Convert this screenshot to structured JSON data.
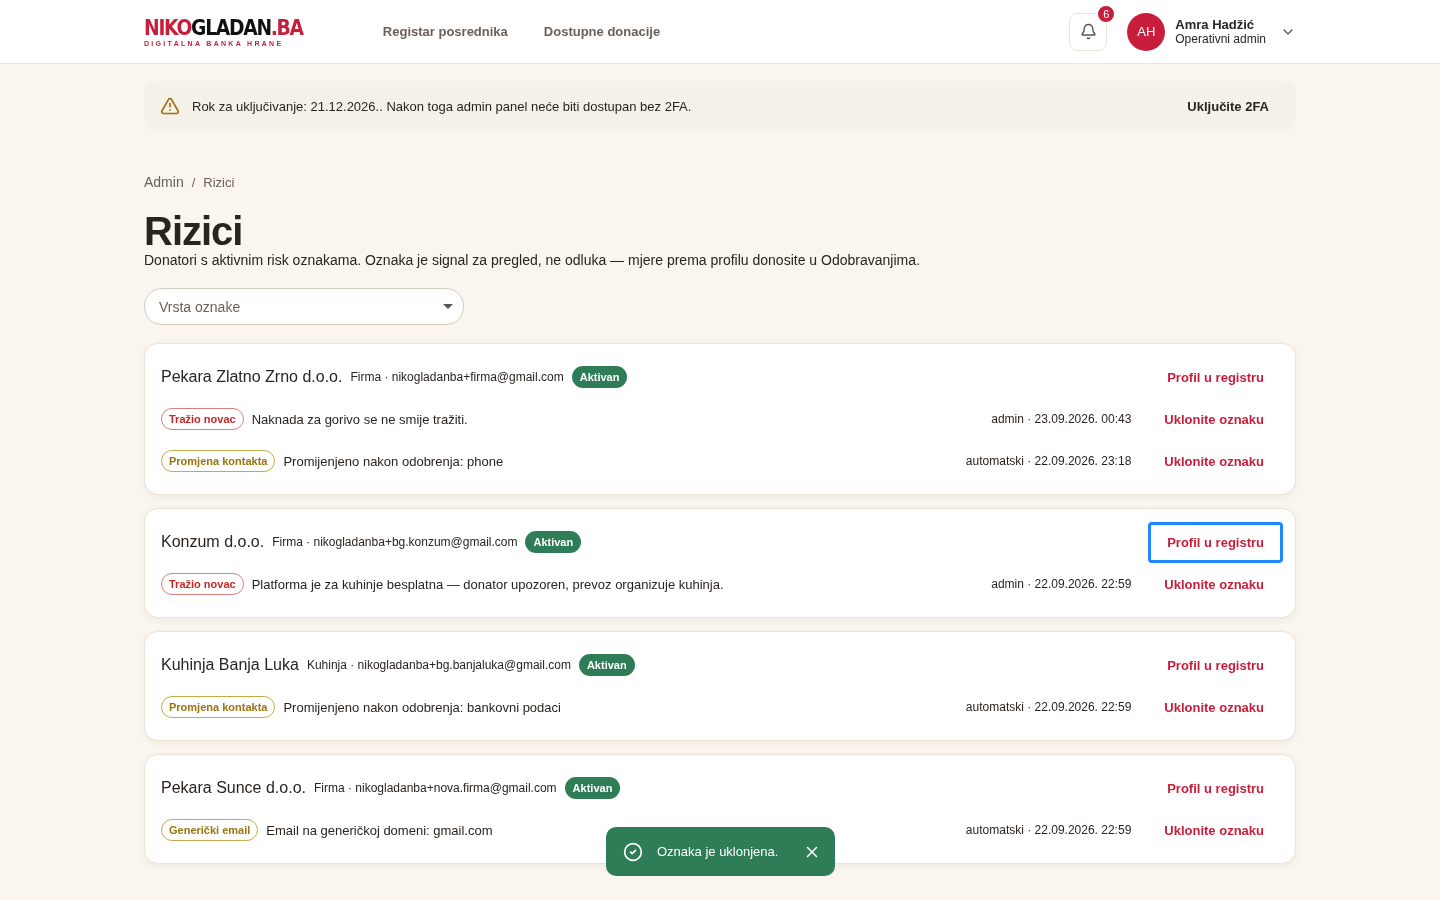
{
  "header": {
    "logo": {
      "parts": [
        {
          "text": "NIKO",
          "kind": "accent"
        },
        {
          "text": "GLADAN",
          "kind": "plain"
        },
        {
          "text": ".BA",
          "kind": "accent"
        }
      ],
      "tagline": "DIGITALNA BANKA HRANE"
    },
    "nav": [
      "Registar posrednika",
      "Dostupne donacije"
    ],
    "notifications": {
      "count": "6"
    },
    "user": {
      "initials": "AH",
      "name": "Amra Hadžić",
      "role": "Operativni admin"
    }
  },
  "alert": {
    "text": "Rok za uključivanje: 21.12.2026.. Nakon toga admin panel neće biti dostupan bez 2FA.",
    "action": "Uključite 2FA"
  },
  "breadcrumb": {
    "items": [
      "Admin",
      "Rizici"
    ],
    "separator": "/"
  },
  "title": "Rizici",
  "subtitle": "Donatori s aktivnim risk oznakama. Oznaka je signal za pregled, ne odluka — mjere prema profilu donosite u Odobravanjima.",
  "filter": {
    "placeholder": "Vrsta oznake"
  },
  "cards": [
    {
      "name": "Pekara Zlatno Zrno d.o.o.",
      "meta": "Firma · nikogladanba+firma@gmail.com",
      "status": "Aktivan",
      "link": "Profil u registru",
      "focused": false,
      "flags": [
        {
          "tag": "Tražio novac",
          "kind": "danger",
          "text": "Naknada za gorivo se ne smije tražiti.",
          "by": "admin · 23.09.2026. 00:43",
          "action": "Uklonite oznaku"
        },
        {
          "tag": "Promjena kontakta",
          "kind": "warning",
          "text": "Promijenjeno nakon odobrenja: phone",
          "by": "automatski · 22.09.2026. 23:18",
          "action": "Uklonite oznaku"
        }
      ]
    },
    {
      "name": "Konzum d.o.o.",
      "meta": "Firma · nikogladanba+bg.konzum@gmail.com",
      "status": "Aktivan",
      "link": "Profil u registru",
      "focused": true,
      "flags": [
        {
          "tag": "Tražio novac",
          "kind": "danger",
          "text": "Platforma je za kuhinje besplatna — donator upozoren, prevoz organizuje kuhinja.",
          "by": "admin · 22.09.2026. 22:59",
          "action": "Uklonite oznaku"
        }
      ]
    },
    {
      "name": "Kuhinja Banja Luka",
      "meta": "Kuhinja · nikogladanba+bg.banjaluka@gmail.com",
      "status": "Aktivan",
      "link": "Profil u registru",
      "focused": false,
      "flags": [
        {
          "tag": "Promjena kontakta",
          "kind": "warning",
          "text": "Promijenjeno nakon odobrenja: bankovni podaci",
          "by": "automatski · 22.09.2026. 22:59",
          "action": "Uklonite oznaku"
        }
      ]
    },
    {
      "name": "Pekara Sunce d.o.o.",
      "meta": "Firma · nikogladanba+nova.firma@gmail.com",
      "status": "Aktivan",
      "link": "Profil u registru",
      "focused": false,
      "flags": [
        {
          "tag": "Generički email",
          "kind": "warning",
          "text": "Email na generičkoj domeni: gmail.com",
          "by": "automatski · 22.09.2026. 22:59",
          "action": "Uklonite oznaku"
        }
      ]
    }
  ],
  "toast": {
    "text": "Oznaka je uklonjena."
  }
}
